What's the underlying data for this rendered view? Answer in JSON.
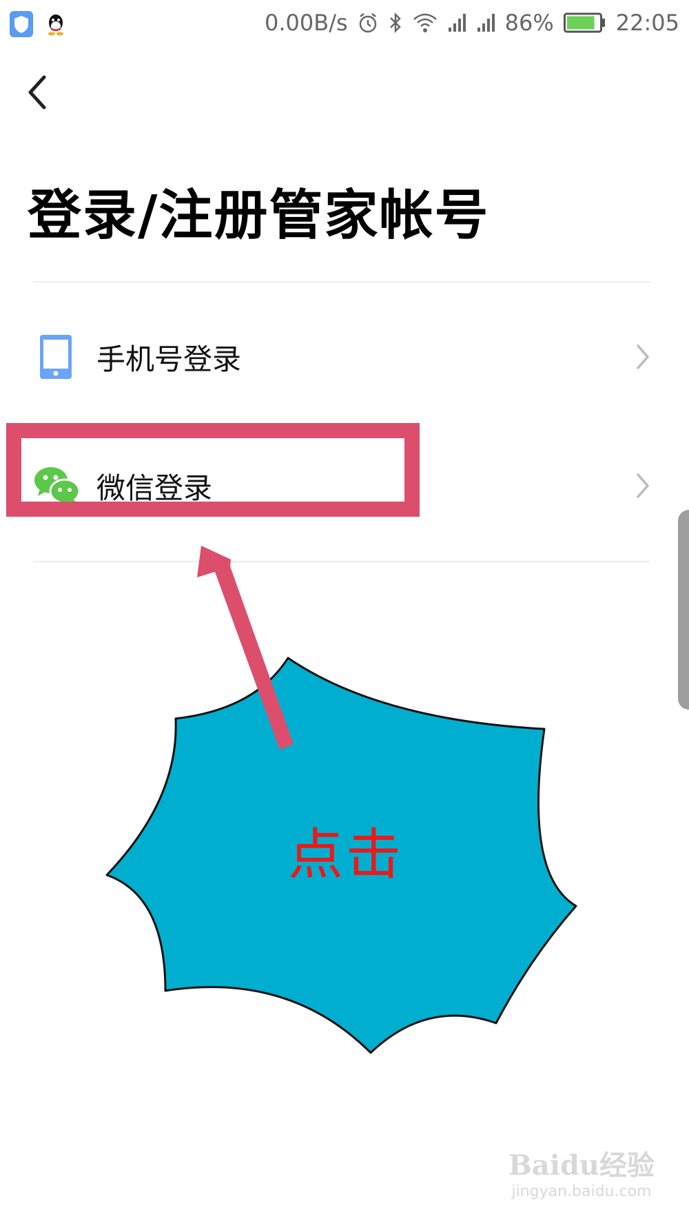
{
  "status_bar": {
    "net_speed": "0.00B/s",
    "battery_percent": "86%",
    "battery_level": 0.86,
    "time": "22:05",
    "icons": [
      "shield-app-icon",
      "qq-icon",
      "alarm-icon",
      "bluetooth-icon",
      "wifi-icon",
      "signal-icon",
      "signal-icon",
      "battery-icon"
    ]
  },
  "header": {
    "title": "登录/注册管家帐号"
  },
  "login_options": [
    {
      "label": "手机号登录",
      "icon": "phone-icon"
    },
    {
      "label": "微信登录",
      "icon": "wechat-icon"
    }
  ],
  "annotation": {
    "callout_text": "点击",
    "highlight_color": "#dd4e6c",
    "burst_color": "#00afcf",
    "text_color": "#e81a1a"
  },
  "watermark": {
    "main": "Baidu经验",
    "sub": "jingyan.baidu.com"
  },
  "colors": {
    "phone_icon": "#6aa4f5",
    "wechat_icon": "#5bc84a",
    "chevron": "#b8bcc4"
  }
}
